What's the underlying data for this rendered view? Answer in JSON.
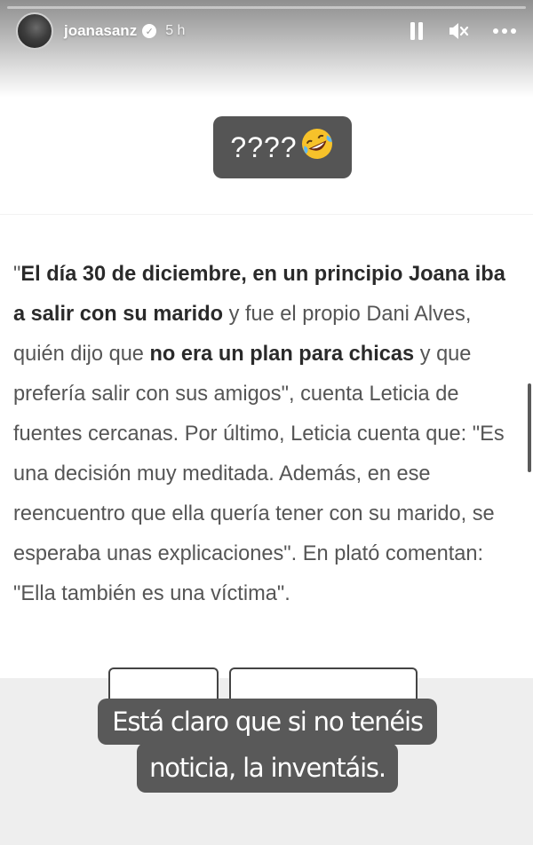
{
  "story": {
    "progress": 0.0,
    "username": "joanasanz",
    "verified": true,
    "time_ago": "5 h",
    "controls": [
      "pause-icon",
      "mute-icon",
      "more-icon"
    ]
  },
  "sticker": {
    "text": "????",
    "emoji": "rolling-on-the-floor-laughing-icon"
  },
  "article": {
    "segments": [
      {
        "text": "\"",
        "bold": false
      },
      {
        "text": "El día 30 de diciembre, en un principio Joana iba a salir con su marido",
        "bold": true
      },
      {
        "text": " y fue el propio Dani Alves, quién dijo que ",
        "bold": false
      },
      {
        "text": "no era un plan para chicas",
        "bold": true
      },
      {
        "text": " y que prefería salir con sus amigos\", cuenta Leticia de fuentes cercanas. Por último, Leticia cuenta que: \"Es una decisión muy meditada. Además, en ese reencuentro que ella quería tener con su marido, se esperaba unas explicaciones\". En plató comentan: \"Ella también es una víctima\".",
        "bold": false
      }
    ]
  },
  "caption": {
    "line1": "Está claro que si no tenéis",
    "line2": "noticia, la inventáis."
  }
}
